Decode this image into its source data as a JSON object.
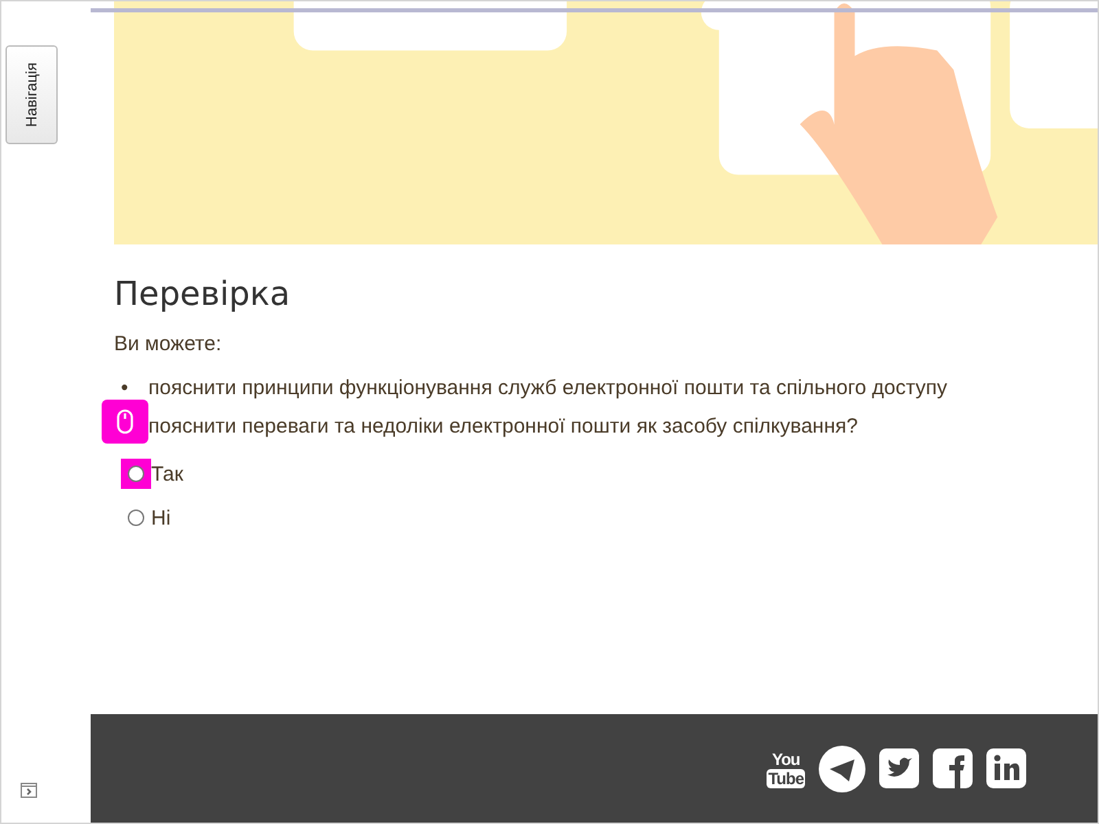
{
  "sidebar": {
    "nav_button": "Навігація"
  },
  "section": {
    "heading": "Перевірка",
    "intro": "Ви можете:",
    "goals": [
      {
        "marker": "•",
        "text": "пояснити принципи функціонування служб електронної пошти та спільного доступу"
      },
      {
        "text": "пояснити переваги та недоліки електронної пошти як засобу спілкування?"
      }
    ],
    "options": [
      {
        "label": "Так",
        "selected": false,
        "highlighted": true
      },
      {
        "label": "Ні",
        "selected": false,
        "highlighted": false
      }
    ]
  },
  "footer": {
    "socials": [
      {
        "kind": "youtube",
        "top": "You",
        "bottom": "Tube"
      },
      {
        "kind": "telegram"
      },
      {
        "kind": "twitter"
      },
      {
        "kind": "facebook"
      },
      {
        "kind": "linkedin"
      }
    ]
  }
}
